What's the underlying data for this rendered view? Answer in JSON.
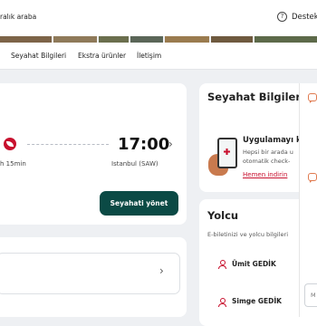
{
  "topbar": {
    "car_link": "ralık araba",
    "support_label": "Destek"
  },
  "subnav": {
    "items": [
      "Seyahat Bilgileri",
      "Ekstra ürünler",
      "İletişim"
    ]
  },
  "flight": {
    "duration": "h 15min",
    "arrival_time": "17:00",
    "destination": "Istanbul (SAW)",
    "manage_label": "Seyahati yönet"
  },
  "travel_info": {
    "title": "Seyahat Bilgileri",
    "app_title": "Uygulamayı k",
    "app_desc_line1": "Hepsi bir arada u",
    "app_desc_line2": "otomatik check-",
    "app_link": "Hemen indirin"
  },
  "passengers": {
    "title": "Yolcu",
    "description": "E-biletinizi ve yolcu bilgileri",
    "items": [
      {
        "name": "Ümit GEDİK"
      },
      {
        "name": "Simge GEDİK"
      }
    ]
  },
  "side": {
    "input_placeholder": "M"
  },
  "colors": {
    "brand_red": "#c8102e",
    "primary_button": "#0b4a45",
    "chat_accent": "#e07a4f"
  }
}
